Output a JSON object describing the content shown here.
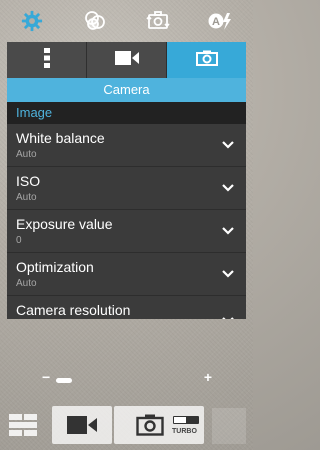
{
  "tabs": [
    {
      "name": "more-settings",
      "icon": "vertical-dots-icon",
      "active": false
    },
    {
      "name": "video",
      "icon": "video-camera-icon",
      "active": false
    },
    {
      "name": "camera",
      "icon": "camera-icon",
      "active": true
    }
  ],
  "panel": {
    "title": "Camera",
    "category": "Image",
    "settings": [
      {
        "label": "White balance",
        "value": "Auto"
      },
      {
        "label": "ISO",
        "value": "Auto"
      },
      {
        "label": "Exposure value",
        "value": "0"
      },
      {
        "label": "Optimization",
        "value": "Auto"
      },
      {
        "label": "Camera resolution",
        "value": ""
      }
    ]
  },
  "zoom": {
    "minus": "−",
    "plus": "+",
    "level": 0.05
  },
  "shutter": {
    "turbo_label": "TURBO"
  },
  "colors": {
    "accent": "#37a9d8",
    "panel": "#3b3b3b"
  }
}
